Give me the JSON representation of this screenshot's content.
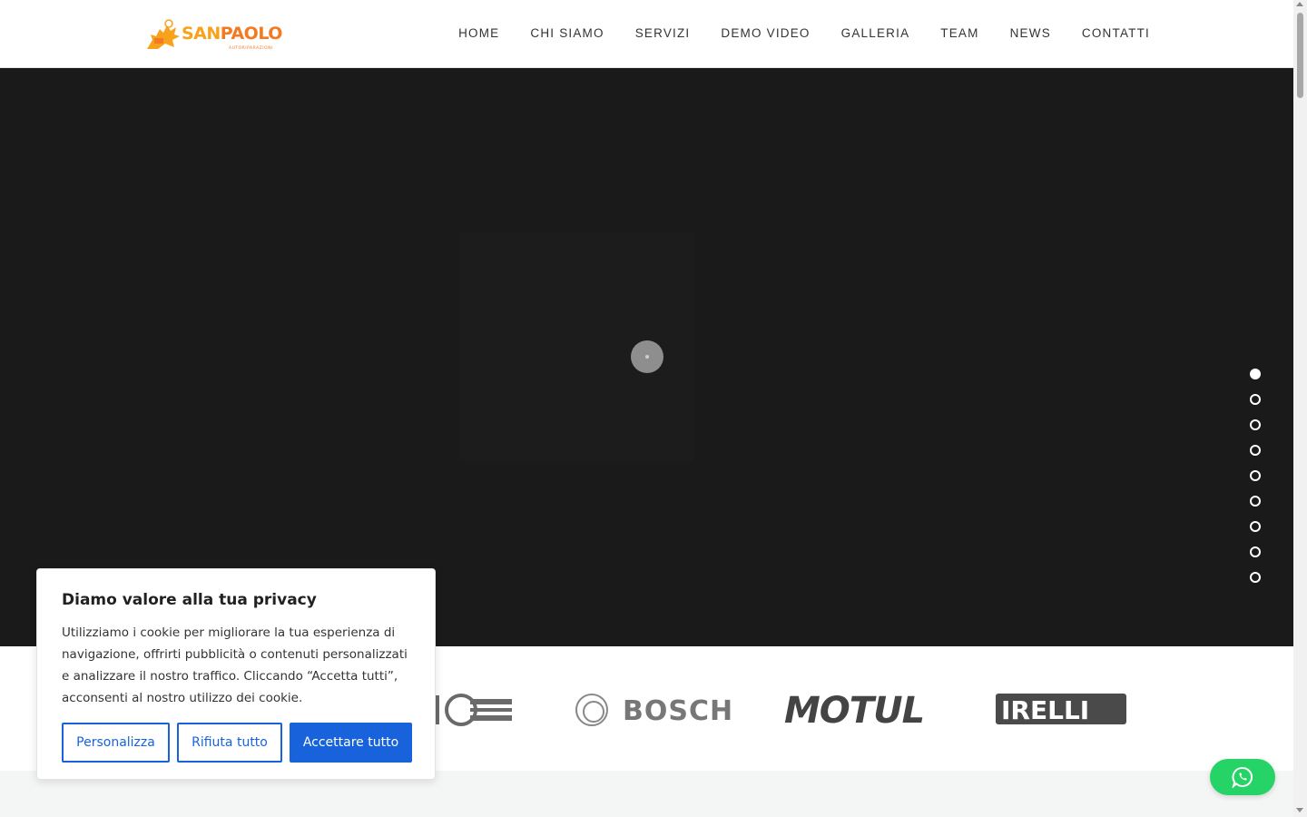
{
  "header": {
    "logo": {
      "text_part1": "SAN",
      "text_part2": "PAOLO",
      "subtitle": "AUTORIPARAZIONI",
      "icon": "lion-logo-icon"
    },
    "nav": [
      {
        "label": "HOME"
      },
      {
        "label": "CHI SIAMO"
      },
      {
        "label": "SERVIZI"
      },
      {
        "label": "DEMO VIDEO"
      },
      {
        "label": "GALLERIA"
      },
      {
        "label": "TEAM"
      },
      {
        "label": "NEWS"
      },
      {
        "label": "CONTATTI"
      }
    ]
  },
  "hero": {
    "loader_icon": "loading-spinner-icon",
    "slider_dots_count": 9,
    "active_dot": 0
  },
  "brands": [
    {
      "name": "brand-partial-logo"
    },
    {
      "name": "bosch-logo",
      "label": "BOSCH"
    },
    {
      "name": "motul-logo",
      "label": "MOTUL"
    },
    {
      "name": "pirelli-logo",
      "label": "IRELLI"
    }
  ],
  "cookie_banner": {
    "title": "Diamo valore alla tua privacy",
    "text": "Utilizziamo i cookie per migliorare la tua esperienza di navigazione, offrirti pubblicità o contenuti personalizzati e analizzare il nostro traffico. Cliccando “Accetta tutti”, acconsenti al nostro utilizzo dei cookie.",
    "buttons": {
      "customize": "Personalizza",
      "reject": "Rifiuta tutto",
      "accept": "Accettare tutto"
    }
  },
  "whatsapp": {
    "icon": "whatsapp-icon"
  },
  "colors": {
    "accent_blue": "#1863dc",
    "whatsapp_green": "#25d366",
    "logo_yellow": "#f7a21a",
    "logo_orange": "#f47a20",
    "hero_bg": "#1a1a1a"
  }
}
